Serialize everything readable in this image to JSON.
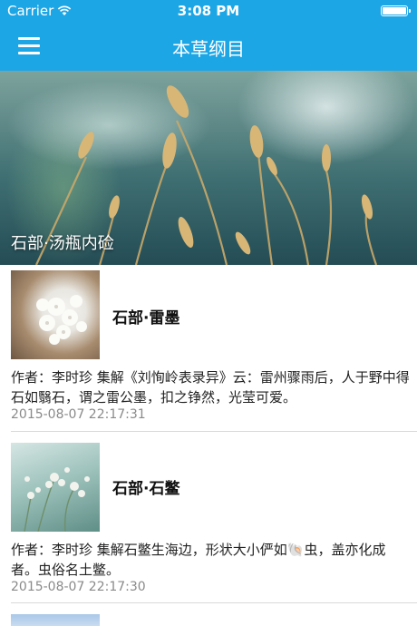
{
  "status_bar": {
    "carrier": "Carrier",
    "time": "3:08 PM"
  },
  "nav": {
    "title": "本草纲目"
  },
  "banner": {
    "caption": "石部·汤瓶内硷"
  },
  "articles": [
    {
      "title": "石部·雷墨",
      "summary": "作者：李时珍 集解《刘恂岭表录异》云：雷州骤雨后，人于野中得石如翳石，谓之雷公墨，扣之铮然，光莹可爱。",
      "date": "2015-08-07 22:17:31"
    },
    {
      "title": "石部·石鳖",
      "summary": "作者：李时珍 集解石鳖生海边，形状大小俨如🐚虫，盖亦化成者。虫俗名土鳖。",
      "date": "2015-08-07 22:17:30"
    }
  ],
  "colors": {
    "nav_bar": "#1da6e6",
    "text": "#111111",
    "date": "#8a8a8a",
    "divider": "#d9d9d9"
  },
  "icons": {
    "menu": "hamburger-menu-icon",
    "wifi": "wifi-icon",
    "battery": "battery-icon"
  }
}
